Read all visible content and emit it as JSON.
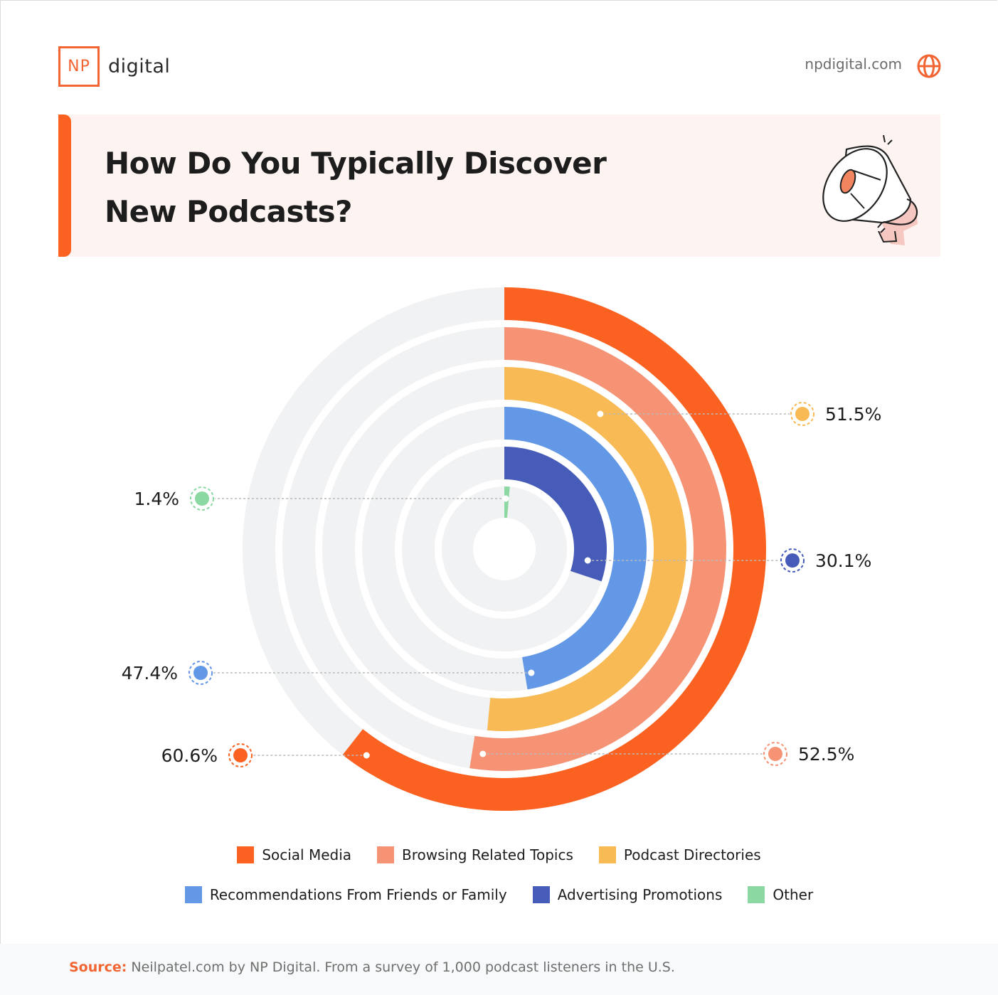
{
  "header": {
    "logo_mark": "NP",
    "logo_word": "digital",
    "site": "npdigital.com",
    "globe_icon": "globe-icon",
    "title_line1": "How Do You Typically Discover",
    "title_line2": "New Podcasts?",
    "illustration": "megaphone-icon"
  },
  "colors": {
    "brand": "#f26532",
    "track": "#f1f2f3"
  },
  "chart_data": {
    "type": "radial-bar",
    "title": "How Do You Typically Discover New Podcasts?",
    "unit": "%",
    "max": 100,
    "series": [
      {
        "name": "Social Media",
        "value": 60.6,
        "label": "60.6%",
        "color": "#fb6222"
      },
      {
        "name": "Browsing Related Topics",
        "value": 52.5,
        "label": "52.5%",
        "color": "#f59374"
      },
      {
        "name": "Podcast Directories",
        "value": 51.5,
        "label": "51.5%",
        "color": "#f8ba55"
      },
      {
        "name": "Recommendations From Friends or Family",
        "value": 47.4,
        "label": "47.4%",
        "color": "#6398e6"
      },
      {
        "name": "Advertising Promotions",
        "value": 30.1,
        "label": "30.1%",
        "color": "#465cb8"
      },
      {
        "name": "Other",
        "value": 1.4,
        "label": "1.4%",
        "color": "#8bd8a2"
      }
    ],
    "legend_position": "bottom"
  },
  "legend": {
    "row1": [
      {
        "label": "Social Media",
        "color": "#fb6222"
      },
      {
        "label": "Browsing Related Topics",
        "color": "#f59374"
      },
      {
        "label": "Podcast Directories",
        "color": "#f8ba55"
      }
    ],
    "row2": [
      {
        "label": "Recommendations From Friends or Family",
        "color": "#6398e6"
      },
      {
        "label": "Advertising Promotions",
        "color": "#465cb8"
      },
      {
        "label": "Other",
        "color": "#8bd8a2"
      }
    ]
  },
  "footer": {
    "source_label": "Source:",
    "source_text": " Neilpatel.com by NP Digital. From a survey of 1,000 podcast listeners in the U.S."
  }
}
